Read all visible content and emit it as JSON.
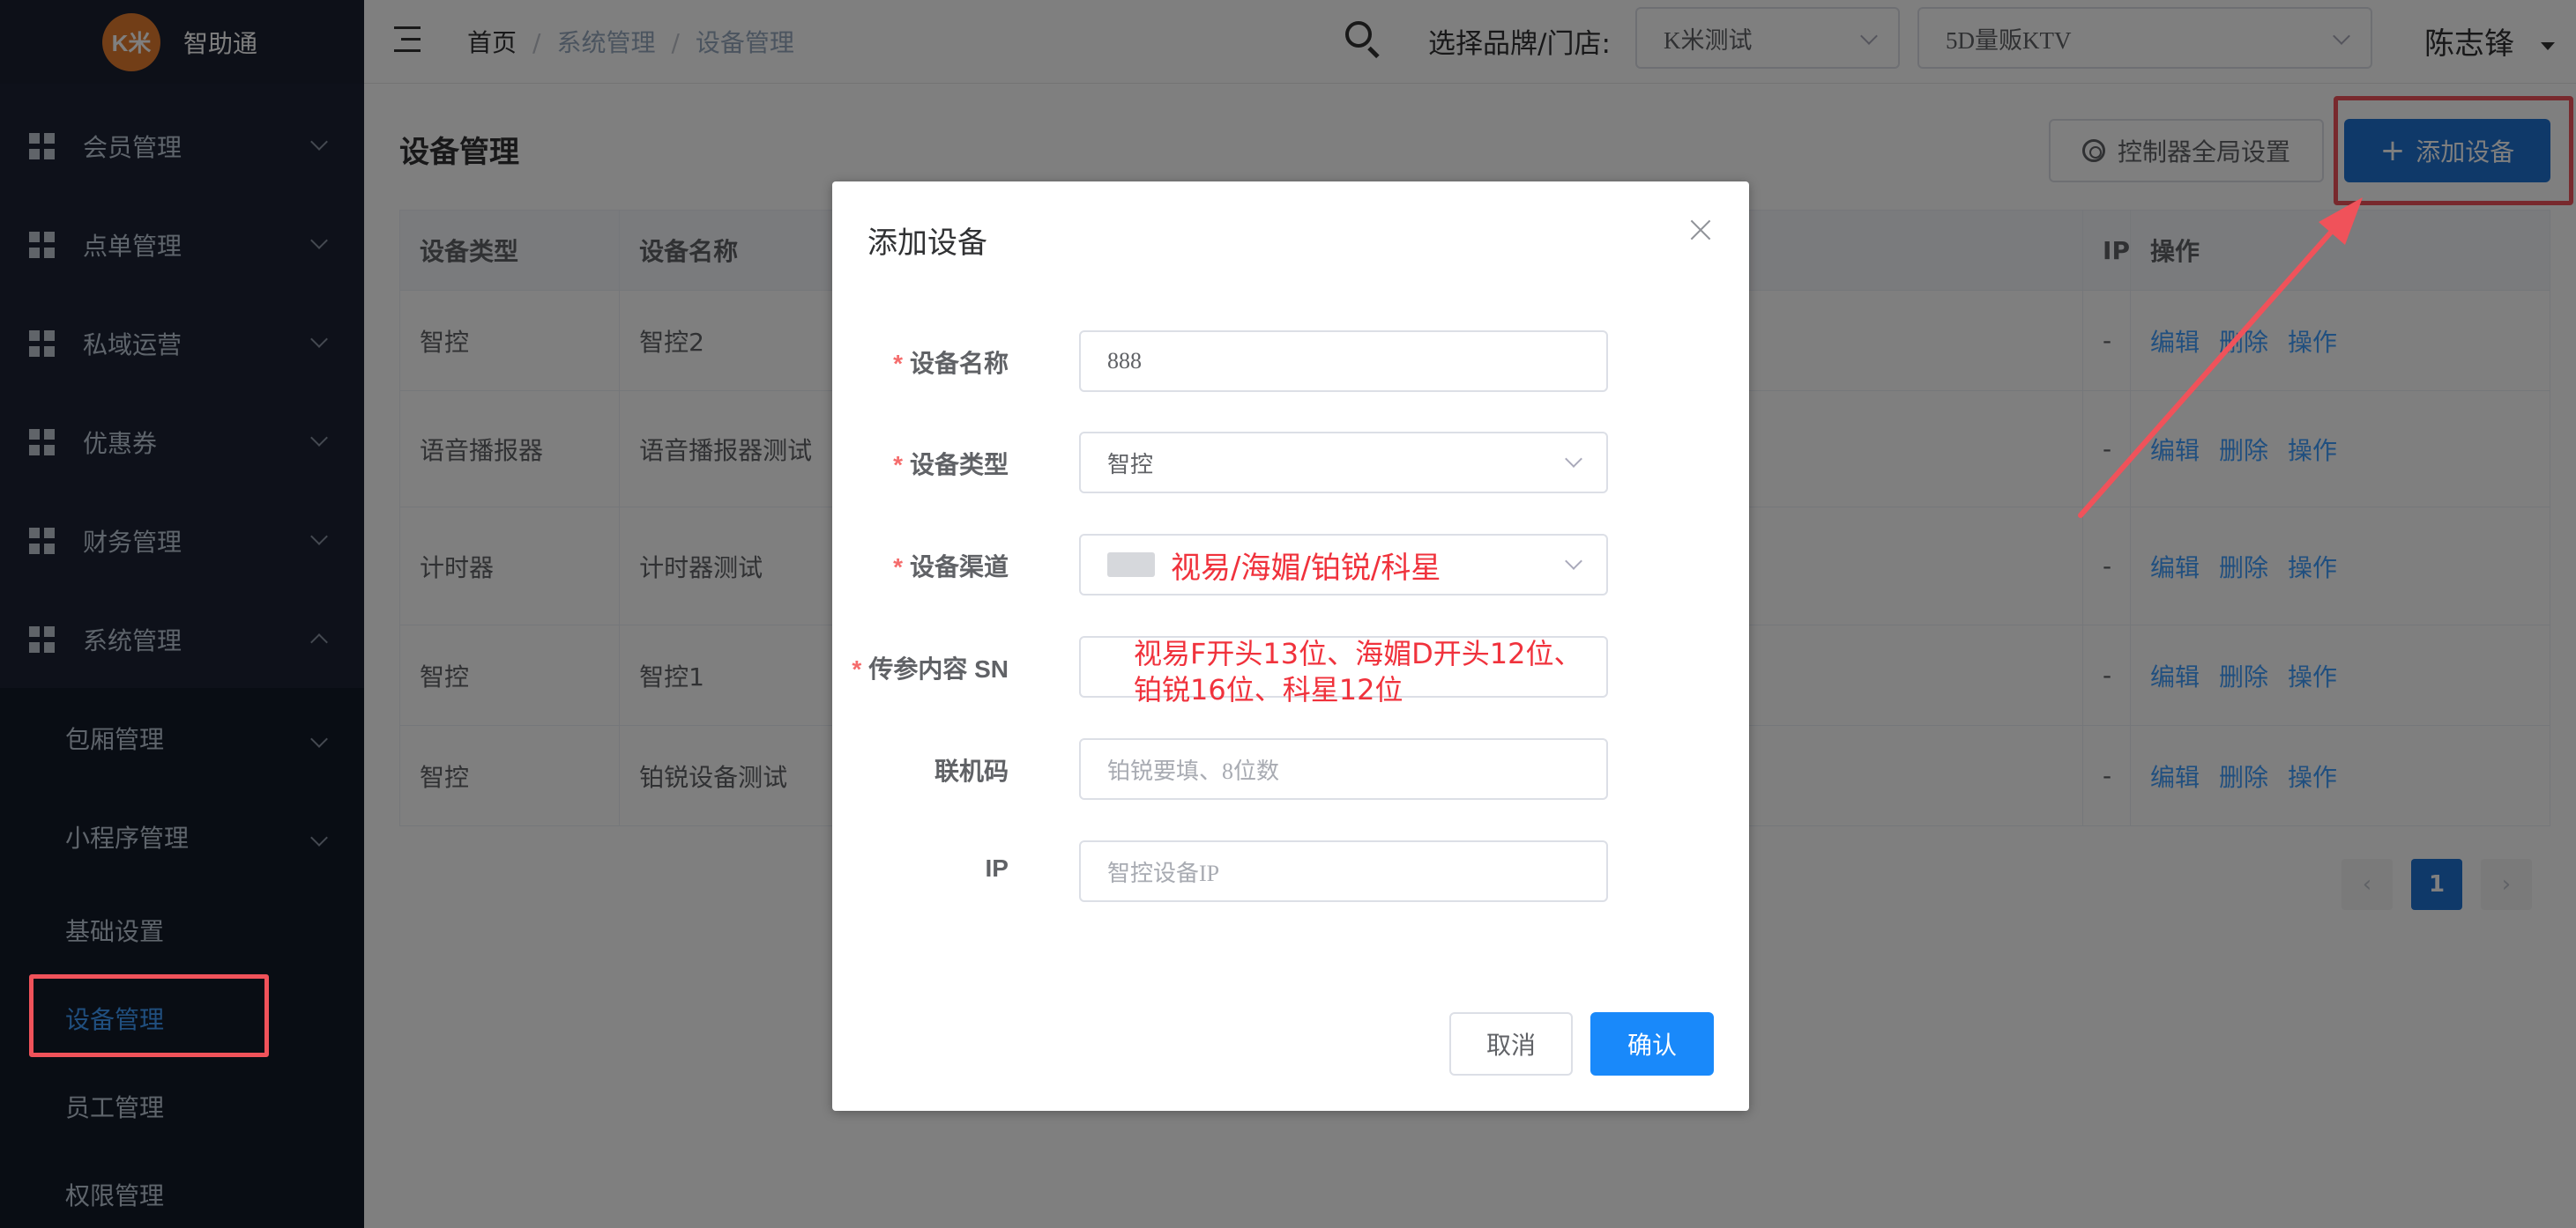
{
  "app": {
    "logo_text": "K米",
    "name": "智助通"
  },
  "sidebar": {
    "items": [
      {
        "label": "会员管理"
      },
      {
        "label": "点单管理"
      },
      {
        "label": "私域运营"
      },
      {
        "label": "优惠券"
      },
      {
        "label": "财务管理"
      },
      {
        "label": "系统管理"
      }
    ],
    "sub_items": [
      {
        "label": "包厢管理"
      },
      {
        "label": "小程序管理"
      },
      {
        "label": "基础设置"
      },
      {
        "label": "设备管理"
      },
      {
        "label": "员工管理"
      },
      {
        "label": "权限管理"
      }
    ]
  },
  "header": {
    "breadcrumb": [
      "首页",
      "系统管理",
      "设备管理"
    ],
    "brand_store_label": "选择品牌/门店:",
    "brand_select": "K米测试",
    "store_select": "5D量贩KTV",
    "user": "陈志锋"
  },
  "main": {
    "title": "设备管理",
    "global_settings_button": "控制器全局设置",
    "add_button": "添加设备",
    "table": {
      "headers": [
        "设备类型",
        "设备名称",
        "IP",
        "操作"
      ],
      "rows": [
        {
          "type": "智控",
          "name": "智控2",
          "ip": "-"
        },
        {
          "type": "语音播报器",
          "name": "语音播报器测试",
          "ip": "-"
        },
        {
          "type": "计时器",
          "name": "计时器测试",
          "ip": "-"
        },
        {
          "type": "智控",
          "name": "智控1",
          "ip": "-"
        },
        {
          "type": "智控",
          "name": "铂锐设备测试",
          "ip": "-"
        }
      ],
      "actions": [
        "编辑",
        "删除",
        "操作"
      ]
    },
    "pagination": {
      "current": "1"
    }
  },
  "dialog": {
    "title": "添加设备",
    "fields": {
      "name": {
        "label": "设备名称",
        "value": "888"
      },
      "type": {
        "label": "设备类型",
        "value": "智控"
      },
      "channel": {
        "label": "设备渠道",
        "annotation": "视易/海媚/铂锐/科星"
      },
      "sn": {
        "label": "传参内容 SN",
        "annotation_line1": "视易F开头13位、海媚D开头12位、",
        "annotation_line2": "铂锐16位、科星12位"
      },
      "code": {
        "label": "联机码",
        "placeholder": "铂锐要填、8位数"
      },
      "ip": {
        "label": "IP",
        "placeholder": "智控设备IP"
      }
    },
    "cancel": "取消",
    "confirm": "确认"
  },
  "colors": {
    "accent": "#1f73d3",
    "annotation_red": "#f0323c",
    "sidebar_bg": "#1c2334"
  }
}
